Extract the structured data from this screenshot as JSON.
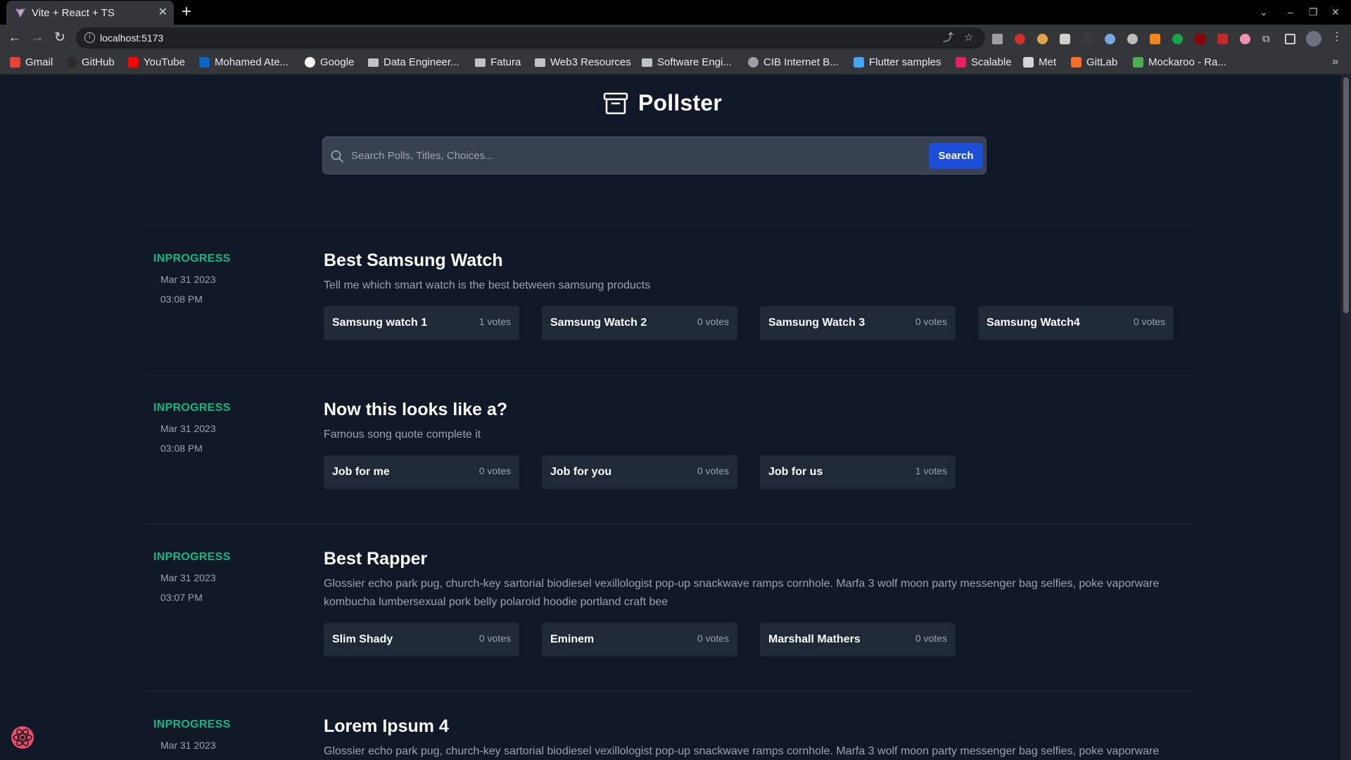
{
  "browser": {
    "tab_title": "Vite + React + TS",
    "url": "localhost:5173",
    "bookmarks": [
      {
        "label": "Gmail",
        "icon": "gmail-icon",
        "color": "#ea4335"
      },
      {
        "label": "GitHub",
        "icon": "github-icon",
        "color": "#2b2b2b"
      },
      {
        "label": "YouTube",
        "icon": "youtube-icon",
        "color": "#ff0000"
      },
      {
        "label": "Mohamed Ate...",
        "icon": "linkedin-icon",
        "color": "#0a66c2"
      },
      {
        "label": "Google",
        "icon": "google-icon",
        "color": "#ffffff"
      },
      {
        "label": "Data Engineer...",
        "icon": "folder-icon",
        "color": "#bfc3c8"
      },
      {
        "label": "Fatura",
        "icon": "folder-icon",
        "color": "#bfc3c8"
      },
      {
        "label": "Web3 Resources",
        "icon": "folder-icon",
        "color": "#bfc3c8"
      },
      {
        "label": "Software Engi...",
        "icon": "folder-icon",
        "color": "#bfc3c8"
      },
      {
        "label": "CIB Internet B...",
        "icon": "globe-icon",
        "color": "#9aa0a6"
      },
      {
        "label": "Flutter samples",
        "icon": "flutter-icon",
        "color": "#42a5f5"
      },
      {
        "label": "Scalable",
        "icon": "scalable-icon",
        "color": "#e91e63"
      },
      {
        "label": "Met",
        "icon": "met-icon",
        "color": "#d6d6d6"
      },
      {
        "label": "GitLab",
        "icon": "gitlab-icon",
        "color": "#fc6d26"
      },
      {
        "label": "Mockaroo - Ra...",
        "icon": "mockaroo-icon",
        "color": "#4caf50"
      }
    ]
  },
  "app": {
    "title": "Pollster",
    "search_placeholder": "Search Polls, Titles, Choices...",
    "search_button": "Search"
  },
  "polls": [
    {
      "status": "INPROGRESS",
      "date": "Mar 31 2023",
      "time": "03:08 PM",
      "title": "Best Samsung Watch",
      "description": "Tell me which smart watch is the best between samsung products",
      "choices": [
        {
          "label": "Samsung watch 1",
          "votes": "1 votes"
        },
        {
          "label": "Samsung Watch 2",
          "votes": "0 votes"
        },
        {
          "label": "Samsung Watch 3",
          "votes": "0 votes"
        },
        {
          "label": "Samsung Watch4",
          "votes": "0 votes"
        }
      ]
    },
    {
      "status": "INPROGRESS",
      "date": "Mar 31 2023",
      "time": "03:08 PM",
      "title": "Now this looks like a?",
      "description": "Famous song quote complete it",
      "choices": [
        {
          "label": "Job for me",
          "votes": "0 votes"
        },
        {
          "label": "Job for you",
          "votes": "0 votes"
        },
        {
          "label": "Job for us",
          "votes": "1 votes"
        }
      ]
    },
    {
      "status": "INPROGRESS",
      "date": "Mar 31 2023",
      "time": "03:07 PM",
      "title": "Best Rapper",
      "description": "Glossier echo park pug, church-key sartorial biodiesel vexillologist pop-up snackwave ramps cornhole. Marfa 3 wolf moon party messenger bag selfies, poke vaporware kombucha lumbersexual pork belly polaroid hoodie portland craft bee",
      "choices": [
        {
          "label": "Slim Shady",
          "votes": "0 votes"
        },
        {
          "label": "Eminem",
          "votes": "0 votes"
        },
        {
          "label": "Marshall Mathers",
          "votes": "0 votes"
        }
      ]
    },
    {
      "status": "INPROGRESS",
      "date": "Mar 31 2023",
      "time": "",
      "title": "Lorem Ipsum 4",
      "description": "Glossier echo park pug, church-key sartorial biodiesel vexillologist pop-up snackwave ramps cornhole. Marfa 3 wolf moon party messenger bag selfies, poke vaporware",
      "choices": []
    }
  ],
  "colors": {
    "background": "#111827",
    "card": "#1f2937",
    "status": "#10b981",
    "accent": "#1d4ed8"
  }
}
